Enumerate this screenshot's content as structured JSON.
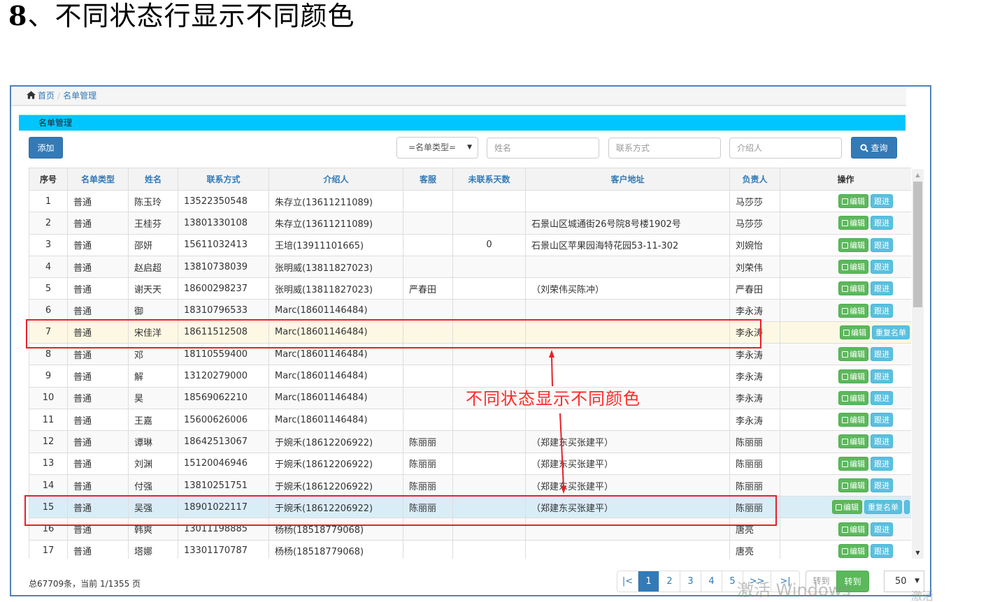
{
  "doc": {
    "title_num": "8",
    "title_text": "、不同状态行显示不同颜色"
  },
  "breadcrumb": {
    "home": "首页",
    "current": "名单管理"
  },
  "panel": {
    "title": "名单管理"
  },
  "toolbar": {
    "add_label": "添加",
    "type_select": "=名单类型=",
    "name_placeholder": "姓名",
    "contact_placeholder": "联系方式",
    "referrer_placeholder": "介绍人",
    "query_label": "查询"
  },
  "table": {
    "headers": [
      "序号",
      "名单类型",
      "姓名",
      "联系方式",
      "介绍人",
      "客服",
      "未联系天数",
      "客户地址",
      "负责人",
      "操作"
    ],
    "rows": [
      {
        "no": "1",
        "type": "普通",
        "name": "陈玉玲",
        "phone": "13522350548",
        "ref": "朱存立(13611211089)",
        "cs": "",
        "days": "",
        "addr": "",
        "owner": "马莎莎",
        "status": "normal",
        "ops": [
          "编辑",
          "跟进"
        ]
      },
      {
        "no": "2",
        "type": "普通",
        "name": "王桂芬",
        "phone": "13801330108",
        "ref": "朱存立(13611211089)",
        "cs": "",
        "days": "",
        "addr": "石景山区城通街26号院8号楼1902号",
        "owner": "马莎莎",
        "status": "normal",
        "ops": [
          "编辑",
          "跟进"
        ]
      },
      {
        "no": "3",
        "type": "普通",
        "name": "邵妍",
        "phone": "15611032413",
        "ref": "王培(13911101665)",
        "cs": "",
        "days": "0",
        "addr": "石景山区苹果园海特花园53-11-302",
        "owner": "刘婉怡",
        "status": "normal",
        "ops": [
          "编辑",
          "跟进"
        ]
      },
      {
        "no": "4",
        "type": "普通",
        "name": "赵启超",
        "phone": "13810738039",
        "ref": "张明威(13811827023)",
        "cs": "",
        "days": "",
        "addr": "",
        "owner": "刘荣伟",
        "status": "normal",
        "ops": [
          "编辑",
          "跟进"
        ]
      },
      {
        "no": "5",
        "type": "普通",
        "name": "谢天天",
        "phone": "18600298237",
        "ref": "张明威(13811827023)",
        "cs": "严春田",
        "days": "",
        "addr": "（刘荣伟买陈冲）",
        "owner": "严春田",
        "status": "normal",
        "ops": [
          "编辑",
          "跟进"
        ]
      },
      {
        "no": "6",
        "type": "普通",
        "name": "御",
        "phone": "18310796533",
        "ref": "Marc(18601146484)",
        "cs": "",
        "days": "",
        "addr": "",
        "owner": "李永涛",
        "status": "normal",
        "ops": [
          "编辑",
          "跟进"
        ]
      },
      {
        "no": "7",
        "type": "普通",
        "name": "宋佳洋",
        "phone": "18611512508",
        "ref": "Marc(18601146484)",
        "cs": "",
        "days": "",
        "addr": "",
        "owner": "李永涛",
        "status": "warning",
        "ops": [
          "编辑",
          "重复名单"
        ]
      },
      {
        "no": "8",
        "type": "普通",
        "name": "邓",
        "phone": "18110559400",
        "ref": "Marc(18601146484)",
        "cs": "",
        "days": "",
        "addr": "",
        "owner": "李永涛",
        "status": "normal",
        "ops": [
          "编辑",
          "跟进"
        ]
      },
      {
        "no": "9",
        "type": "普通",
        "name": "解",
        "phone": "13120279000",
        "ref": "Marc(18601146484)",
        "cs": "",
        "days": "",
        "addr": "",
        "owner": "李永涛",
        "status": "normal",
        "ops": [
          "编辑",
          "跟进"
        ]
      },
      {
        "no": "10",
        "type": "普通",
        "name": "昊",
        "phone": "18569062210",
        "ref": "Marc(18601146484)",
        "cs": "",
        "days": "",
        "addr": "",
        "owner": "李永涛",
        "status": "normal",
        "ops": [
          "编辑",
          "跟进"
        ]
      },
      {
        "no": "11",
        "type": "普通",
        "name": "王嘉",
        "phone": "15600626006",
        "ref": "Marc(18601146484)",
        "cs": "",
        "days": "",
        "addr": "",
        "owner": "李永涛",
        "status": "normal",
        "ops": [
          "编辑",
          "跟进"
        ]
      },
      {
        "no": "12",
        "type": "普通",
        "name": "谭琳",
        "phone": "18642513067",
        "ref": "于婉禾(18612206922)",
        "cs": "陈丽丽",
        "days": "",
        "addr": "（郑建东买张建平）",
        "owner": "陈丽丽",
        "status": "normal",
        "ops": [
          "编辑",
          "跟进"
        ]
      },
      {
        "no": "13",
        "type": "普通",
        "name": "刘渊",
        "phone": "15120046946",
        "ref": "于婉禾(18612206922)",
        "cs": "陈丽丽",
        "days": "",
        "addr": "（郑建东买张建平）",
        "owner": "陈丽丽",
        "status": "normal",
        "ops": [
          "编辑",
          "跟进"
        ]
      },
      {
        "no": "14",
        "type": "普通",
        "name": "付强",
        "phone": "13810251751",
        "ref": "于婉禾(18612206922)",
        "cs": "陈丽丽",
        "days": "",
        "addr": "（郑建东买张建平）",
        "owner": "陈丽丽",
        "status": "normal",
        "ops": [
          "编辑",
          "跟进"
        ]
      },
      {
        "no": "15",
        "type": "普通",
        "name": "吴强",
        "phone": "18901022117",
        "ref": "于婉禾(18612206922)",
        "cs": "陈丽丽",
        "days": "",
        "addr": "（郑建东买张建平）",
        "owner": "陈丽丽",
        "status": "info",
        "ops": [
          "编辑",
          "重复名单",
          ""
        ]
      },
      {
        "no": "16",
        "type": "普通",
        "name": "韩爽",
        "phone": "13011198885",
        "ref": "杨杨(18518779068)",
        "cs": "",
        "days": "",
        "addr": "",
        "owner": "唐亮",
        "status": "normal",
        "ops": [
          "编辑",
          "跟进"
        ]
      },
      {
        "no": "17",
        "type": "普通",
        "name": "塔娜",
        "phone": "13301170787",
        "ref": "杨杨(18518779068)",
        "cs": "",
        "days": "",
        "addr": "",
        "owner": "唐亮",
        "status": "normal",
        "ops": [
          "编辑",
          "跟进"
        ]
      }
    ]
  },
  "footer": {
    "summary": "总67709条，当前 1/1355 页",
    "pages": [
      "|<",
      "1",
      "2",
      "3",
      "4",
      "5",
      ">>",
      ">|"
    ],
    "active_page": "1",
    "goto_placeholder": "转到",
    "goto_label": "转到",
    "page_size": "50"
  },
  "annotation": {
    "text": "不同状态显示不同颜色",
    "color": "#e8202a"
  },
  "watermark": {
    "text": "激活 Windows",
    "text2": "激活"
  },
  "colors": {
    "warning_row": "#fcf8e3",
    "info_row": "#d9edf7",
    "header_bar": "#00c5ff",
    "primary": "#337ab7",
    "success": "#5cb85c",
    "info": "#5bc0de"
  }
}
